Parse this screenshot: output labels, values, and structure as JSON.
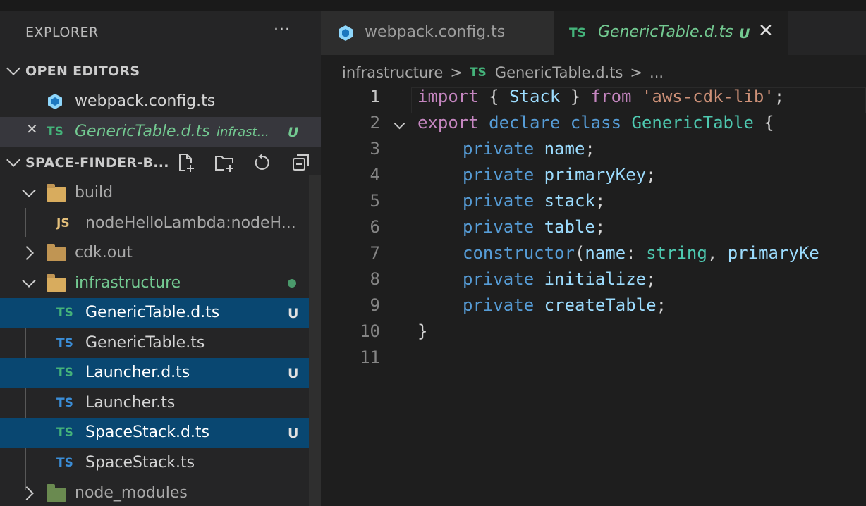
{
  "explorer": {
    "title": "EXPLORER",
    "more": "···",
    "open_editors": {
      "label": "OPEN EDITORS",
      "items": [
        {
          "name": "webpack.config.ts"
        },
        {
          "close": "✕",
          "badge": "TS",
          "name": "GenericTable.d.ts",
          "path": "infrast...",
          "status": "U"
        }
      ]
    },
    "project": {
      "label": "SPACE-FINDER-B...",
      "tree": [
        {
          "name": "build"
        },
        {
          "badge": "JS",
          "name": "nodeHelloLambda:nodeH..."
        },
        {
          "name": "cdk.out"
        },
        {
          "name": "infrastructure"
        },
        {
          "badge": "TS",
          "name": "GenericTable.d.ts",
          "status": "U"
        },
        {
          "badge": "TS",
          "name": "GenericTable.ts"
        },
        {
          "badge": "TS",
          "name": "Launcher.d.ts",
          "status": "U"
        },
        {
          "badge": "TS",
          "name": "Launcher.ts"
        },
        {
          "badge": "TS",
          "name": "SpaceStack.d.ts",
          "status": "U"
        },
        {
          "badge": "TS",
          "name": "SpaceStack.ts"
        },
        {
          "name": "node_modules"
        }
      ]
    }
  },
  "tabs": [
    {
      "label": "webpack.config.ts"
    },
    {
      "badge": "TS",
      "label": "GenericTable.d.ts",
      "status": "U",
      "close": "✕"
    }
  ],
  "breadcrumb": {
    "folder": "infrastructure",
    "sep": ">",
    "badge": "TS",
    "file": "GenericTable.d.ts",
    "tail": "..."
  },
  "code": {
    "line_numbers": [
      "1",
      "2",
      "3",
      "4",
      "5",
      "6",
      "7",
      "8",
      "9",
      "10",
      "11"
    ],
    "l1": {
      "a": "import",
      "b": " { ",
      "c": "Stack",
      "d": " } ",
      "e": "from",
      "f": " ",
      "g": "'aws-cdk-lib'",
      "h": ";"
    },
    "l2": {
      "a": "export",
      "b": " ",
      "c": "declare",
      "d": " ",
      "e": "class",
      "f": " ",
      "g": "GenericTable",
      "h": " {"
    },
    "l3": {
      "a": "private",
      "b": " ",
      "c": "name",
      "d": ";"
    },
    "l4": {
      "a": "private",
      "b": " ",
      "c": "primaryKey",
      "d": ";"
    },
    "l5": {
      "a": "private",
      "b": " ",
      "c": "stack",
      "d": ";"
    },
    "l6": {
      "a": "private",
      "b": " ",
      "c": "table",
      "d": ";"
    },
    "l7": {
      "a": "constructor",
      "b": "(",
      "c": "name",
      "d": ": ",
      "e": "string",
      "f": ", ",
      "g": "primaryKe"
    },
    "l8": {
      "a": "private",
      "b": " ",
      "c": "initialize",
      "d": ";"
    },
    "l9": {
      "a": "private",
      "b": " ",
      "c": "createTable",
      "d": ";"
    },
    "l10": {
      "a": "}"
    }
  },
  "colors": {
    "selection": "#094771",
    "ts_green": "#73c991",
    "ts_blue": "#3b8ed8",
    "modified": "#e2c08d"
  },
  "icons": [
    "webpack-icon",
    "ts-file-icon",
    "js-file-icon",
    "folder-icon",
    "node-modules-folder-icon",
    "new-file-icon",
    "new-folder-icon",
    "refresh-icon",
    "collapse-all-icon",
    "close-icon",
    "chevron-down-icon",
    "chevron-right-icon"
  ]
}
